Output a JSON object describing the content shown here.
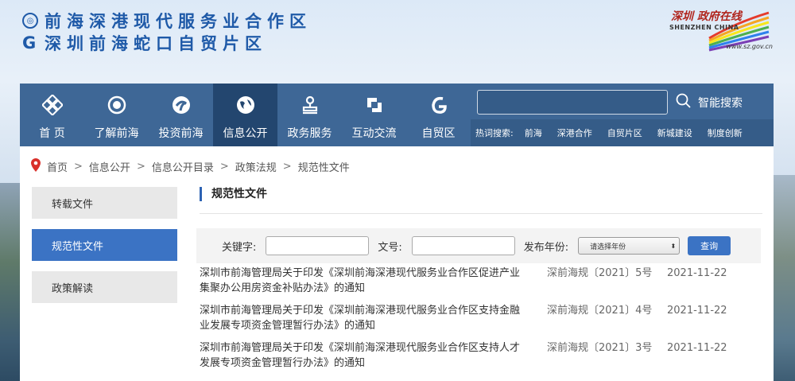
{
  "header": {
    "logo_line1": "前海深港现代服务业合作区",
    "logo_line2": "深圳前海蛇口自贸片区",
    "sz_logo_cn": "深圳 政府在线",
    "sz_logo_en": "SHENZHEN CHINA",
    "sz_logo_url": "www.sz.gov.cn"
  },
  "nav": {
    "items": [
      {
        "label": "首 页",
        "icon": "grid-diamond-icon"
      },
      {
        "label": "了解前海",
        "icon": "emblem-icon"
      },
      {
        "label": "投资前海",
        "icon": "swirl-icon"
      },
      {
        "label": "信息公开",
        "icon": "globe-icon",
        "active": true
      },
      {
        "label": "政务服务",
        "icon": "stamp-icon"
      },
      {
        "label": "互动交流",
        "icon": "exchange-icon"
      },
      {
        "label": "自贸区",
        "icon": "g-logo-icon"
      }
    ],
    "search_placeholder": "",
    "smart_search_label": "智能搜索",
    "hot_label": "热词搜索:",
    "hot_links": [
      "前海",
      "深港合作",
      "自贸片区",
      "新城建设",
      "制度创新"
    ]
  },
  "breadcrumb": [
    "首页",
    "信息公开",
    "信息公开目录",
    "政策法规",
    "规范性文件"
  ],
  "side_menu": [
    {
      "label": "转载文件",
      "active": false
    },
    {
      "label": "规范性文件",
      "active": true
    },
    {
      "label": "政策解读",
      "active": false
    }
  ],
  "content": {
    "title": "规范性文件",
    "filter": {
      "keyword_label": "关键字:",
      "docno_label": "文号:",
      "year_label": "发布年份:",
      "year_select": "请选择年份",
      "query_button": "查询"
    },
    "documents": [
      {
        "title": "深圳市前海管理局关于印发《深圳前海深港现代服务业合作区促进产业集聚办公用房资金补贴办法》的通知",
        "doc_no": "深前海规〔2021〕5号",
        "date": "2021-11-22"
      },
      {
        "title": "深圳市前海管理局关于印发《深圳前海深港现代服务业合作区支持金融业发展专项资金管理暂行办法》的通知",
        "doc_no": "深前海规〔2021〕4号",
        "date": "2021-11-22"
      },
      {
        "title": "深圳市前海管理局关于印发《深圳前海深港现代服务业合作区支持人才发展专项资金管理暂行办法》的通知",
        "doc_no": "深前海规〔2021〕3号",
        "date": "2021-11-22"
      }
    ]
  }
}
